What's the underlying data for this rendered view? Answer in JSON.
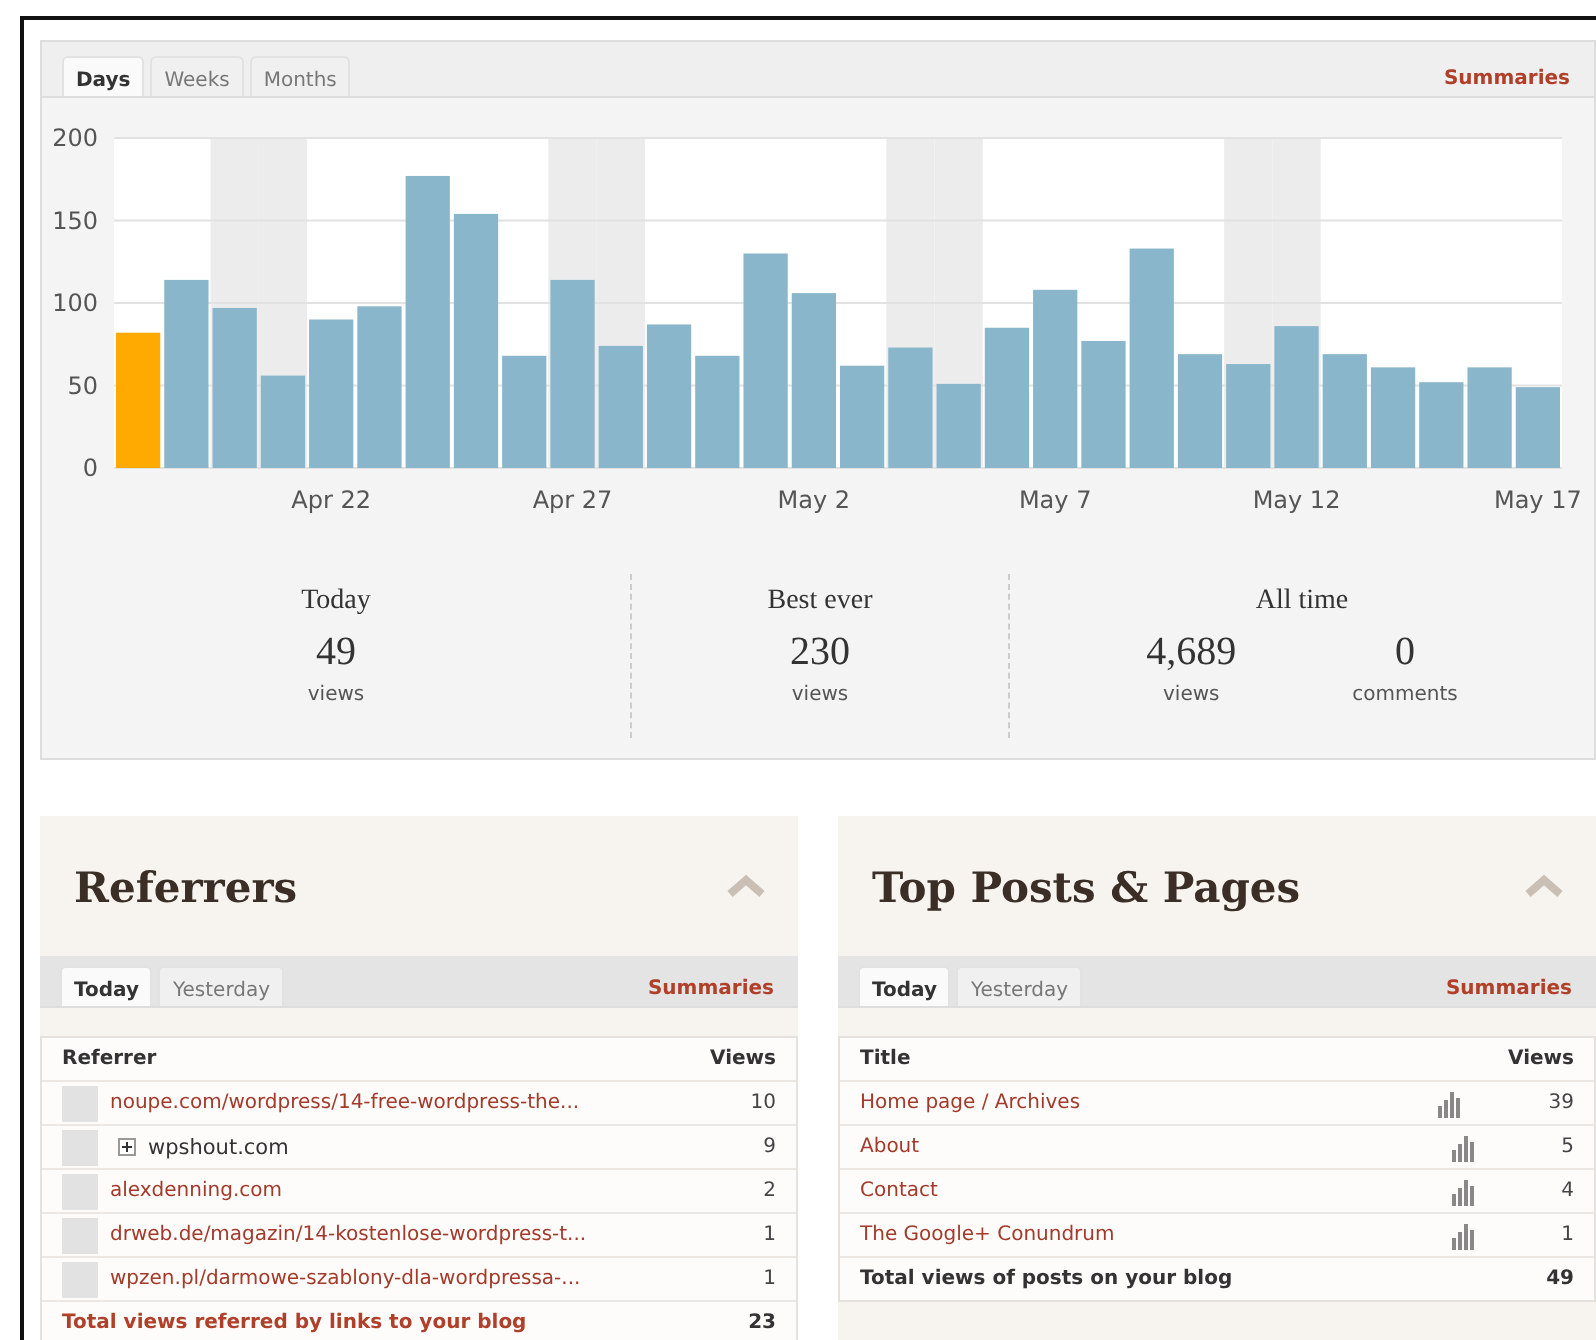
{
  "stats_panel": {
    "tabs": [
      {
        "label": "Days",
        "selected": true
      },
      {
        "label": "Weeks",
        "selected": false
      },
      {
        "label": "Months",
        "selected": false
      }
    ],
    "summaries_link": "Summaries",
    "chart": {
      "chart_data": {
        "type": "bar",
        "grid": true,
        "categories": [
          null,
          null,
          null,
          null,
          "Apr 22",
          null,
          null,
          null,
          null,
          "Apr 27",
          null,
          null,
          null,
          null,
          "May 2",
          null,
          null,
          null,
          null,
          "May 7",
          null,
          null,
          null,
          null,
          "May 12",
          null,
          null,
          null,
          null,
          "May 17"
        ],
        "series": [
          {
            "color": "#8ab6cb",
            "values": [
              null,
              114,
              97,
              56,
              90,
              98,
              177,
              154,
              68,
              114,
              74,
              87,
              68,
              130,
              106,
              62,
              73,
              51,
              85,
              108,
              77,
              133,
              69,
              63,
              86,
              69,
              61,
              52,
              61,
              49
            ]
          },
          {
            "color": "#ffaa00",
            "values": [
              82,
              null,
              null,
              null,
              null,
              null,
              null,
              null,
              null,
              null,
              null,
              null,
              null,
              null,
              null,
              null,
              null,
              null,
              null,
              null,
              null,
              null,
              null,
              null,
              null,
              null,
              null,
              null,
              null,
              null
            ]
          }
        ],
        "ylim": [
          0,
          200
        ],
        "yticks": [
          0,
          50,
          100,
          150,
          200
        ]
      }
    },
    "summary": [
      {
        "title": "Today",
        "figures": [
          {
            "value": "49",
            "unit": "views"
          }
        ]
      },
      {
        "title": "Best ever",
        "figures": [
          {
            "value": "230",
            "unit": "views"
          }
        ]
      },
      {
        "title": "All time",
        "figures": [
          {
            "value": "4,689",
            "unit": "views"
          },
          {
            "value": "0",
            "unit": "comments"
          }
        ]
      }
    ]
  },
  "referrers": {
    "title": "Referrers",
    "tabs": [
      {
        "label": "Today",
        "selected": true
      },
      {
        "label": "Yesterday",
        "selected": false
      }
    ],
    "summaries_link": "Summaries",
    "columns": [
      "Referrer",
      "Views"
    ],
    "rows": [
      {
        "kind": "link",
        "label": "noupe.com/wordpress/14-free-wordpress-the...",
        "views": "10"
      },
      {
        "kind": "group",
        "label": "wpshout.com",
        "views": "9"
      },
      {
        "kind": "link",
        "label": "alexdenning.com",
        "views": "2"
      },
      {
        "kind": "link",
        "label": "drweb.de/magazin/14-kostenlose-wordpress-t...",
        "views": "1"
      },
      {
        "kind": "link",
        "label": "wpzen.pl/darmowe-szablony-dla-wordpressa-...",
        "views": "1"
      }
    ],
    "total": {
      "label": "Total views referred by links to your blog",
      "views": "23"
    }
  },
  "top_posts": {
    "title": "Top Posts & Pages",
    "tabs": [
      {
        "label": "Today",
        "selected": true
      },
      {
        "label": "Yesterday",
        "selected": false
      }
    ],
    "summaries_link": "Summaries",
    "columns": [
      "Title",
      "Views"
    ],
    "rows": [
      {
        "label": "Home page / Archives",
        "views": "39"
      },
      {
        "label": "About",
        "views": "5"
      },
      {
        "label": "Contact",
        "views": "4"
      },
      {
        "label": "The Google+ Conundrum",
        "views": "1"
      }
    ],
    "total": {
      "label": "Total views of posts on your blog",
      "views": "49"
    }
  }
}
